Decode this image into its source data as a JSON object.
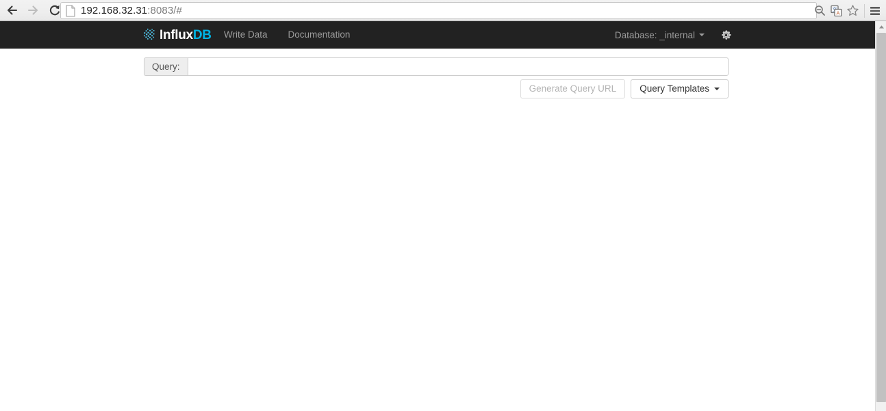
{
  "browser": {
    "back_label": "Back",
    "forward_label": "Forward",
    "reload_label": "Reload",
    "url_main": "192.168.32.31",
    "url_port_path": ":8083/#",
    "icons": {
      "page": "page-icon",
      "zoom_out": "zoom-out-icon",
      "translate": "translate-icon",
      "bookmark": "bookmark-star-icon",
      "menu": "hamburger-menu-icon"
    }
  },
  "navbar": {
    "brand": {
      "influx": "Influx",
      "db": "DB"
    },
    "links": [
      {
        "label": "Write Data"
      },
      {
        "label": "Documentation"
      }
    ],
    "database": {
      "label": "Database: _internal"
    },
    "settings_icon": "gear-icon",
    "colors": {
      "background": "#222222",
      "link": "#9d9d9d",
      "brand_accent": "#00b3e3"
    }
  },
  "query": {
    "addon_label": "Query:",
    "value": "",
    "placeholder": ""
  },
  "buttons": {
    "generate_query_url": "Generate Query URL",
    "query_templates": "Query Templates"
  }
}
